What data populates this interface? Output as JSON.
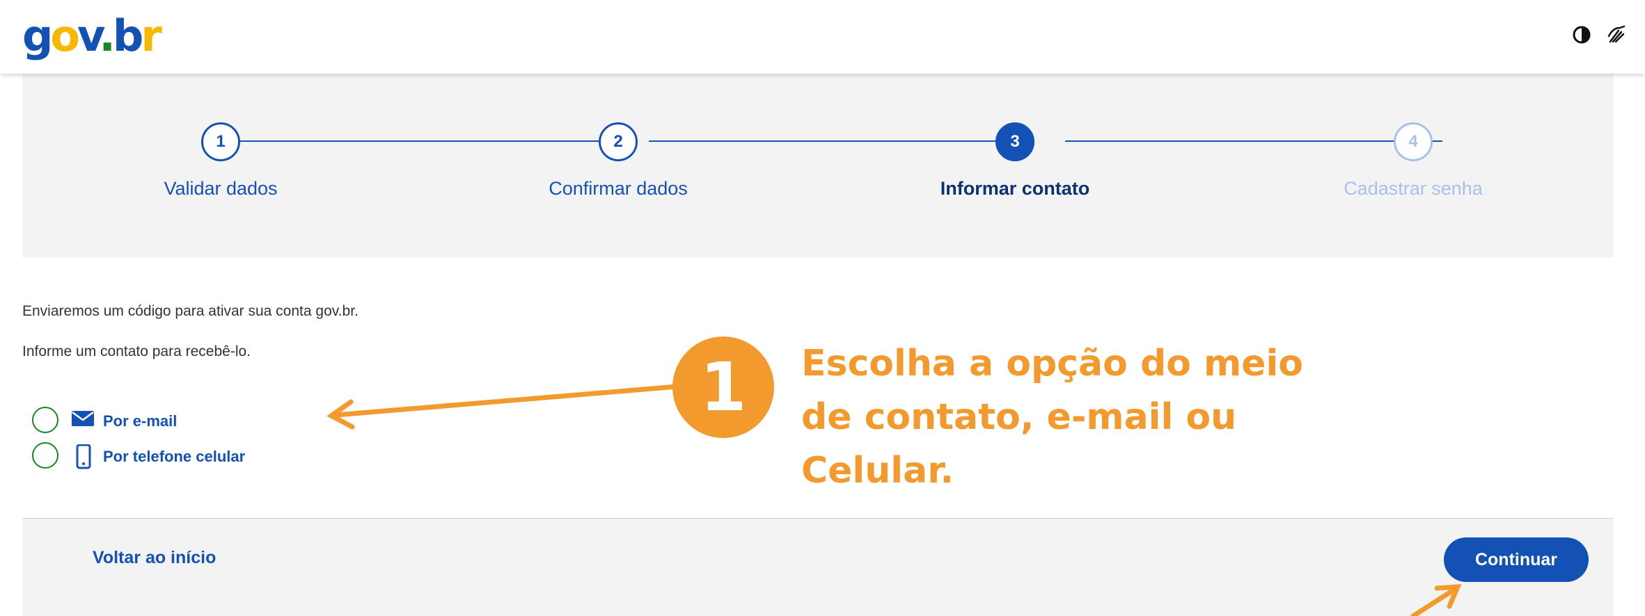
{
  "header": {
    "logo": {
      "g": "g",
      "o": "o",
      "v": "v",
      "dot": ".",
      "b": "b",
      "r": "r"
    },
    "icons": [
      "contrast-icon",
      "libras-hands-icon"
    ]
  },
  "stepper": {
    "steps": [
      {
        "number": "1",
        "label": "Validar dados",
        "state": "done"
      },
      {
        "number": "2",
        "label": "Confirmar dados",
        "state": "done"
      },
      {
        "number": "3",
        "label": "Informar contato",
        "state": "active"
      },
      {
        "number": "4",
        "label": "Cadastrar senha",
        "state": "pending"
      }
    ]
  },
  "content": {
    "line1": "Enviaremos um código para ativar sua conta gov.br.",
    "line2": "Informe um contato para recebê-lo.",
    "options": [
      {
        "label": "Por e-mail",
        "icon": "envelope-icon",
        "selected": false
      },
      {
        "label": "Por telefone celular",
        "icon": "mobile-phone-icon",
        "selected": false
      }
    ]
  },
  "footer": {
    "back_label": "Voltar ao início",
    "continue_label": "Continuar"
  },
  "annotation": {
    "badge": "1",
    "text": "Escolha a opção do meio de contato, e-mail ou Celular."
  },
  "colors": {
    "primary": "#1351b4",
    "primary_dark": "#0c326f",
    "pale": "#a9c1ea",
    "panel_bg": "#f3f3f3",
    "radio_border": "#168821",
    "annotation": "#f29a2e"
  }
}
